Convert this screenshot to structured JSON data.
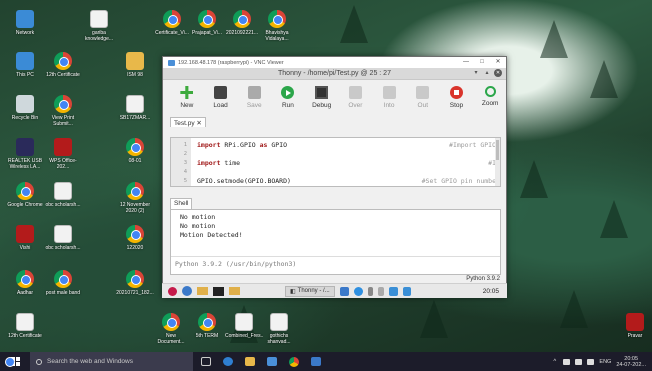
{
  "desktop": {
    "icons": [
      {
        "label": "Network",
        "icon": "network-icon"
      },
      {
        "label": "gariba knowledge...",
        "icon": "document-icon"
      },
      {
        "label": "Certificate_Vi...",
        "icon": "chrome-icon"
      },
      {
        "label": "Prajapat_Vi...",
        "icon": "chrome-icon"
      },
      {
        "label": "2021092221...",
        "icon": "chrome-icon"
      },
      {
        "label": "Bhavishya Vidalaya...",
        "icon": "chrome-icon"
      },
      {
        "label": "This PC",
        "icon": "this-pc-icon"
      },
      {
        "label": "12th Certificate",
        "icon": "chrome-icon"
      },
      {
        "label": "ISM 98",
        "icon": "folder-icon"
      },
      {
        "label": "Recycle Bin",
        "icon": "recycle-bin-icon"
      },
      {
        "label": "View Print Submit...",
        "icon": "chrome-icon"
      },
      {
        "label": "SB17ZMAR...",
        "icon": "document-icon"
      },
      {
        "label": "REALTEK USB Wireless LA...",
        "icon": "realtek-icon"
      },
      {
        "label": "WPS Office-202...",
        "icon": "wps-icon"
      },
      {
        "label": "08-01",
        "icon": "chrome-icon"
      },
      {
        "label": "Google Chrome",
        "icon": "chrome-icon"
      },
      {
        "label": "obc scholarsh...",
        "icon": "document-icon"
      },
      {
        "label": "12 November 2020 (2)",
        "icon": "chrome-icon"
      },
      {
        "label": "Vishi",
        "icon": "vishi-icon"
      },
      {
        "label": "obc scholarsh...",
        "icon": "document-icon"
      },
      {
        "label": "122020",
        "icon": "chrome-icon"
      },
      {
        "label": "Aadhar",
        "icon": "chrome-icon"
      },
      {
        "label": "post male band",
        "icon": "chrome-icon"
      },
      {
        "label": "20210721_182...",
        "icon": "chrome-icon"
      },
      {
        "label": "12th Certificate",
        "icon": "document-icon"
      },
      {
        "label": "New Document...",
        "icon": "chrome-icon"
      },
      {
        "label": "5th TERM",
        "icon": "chrome-icon"
      },
      {
        "label": "Combined_Fres...",
        "icon": "document-icon"
      },
      {
        "label": "gothichs shanvad...",
        "icon": "document-icon"
      },
      {
        "label": "Pravar",
        "icon": "pravar-icon"
      }
    ]
  },
  "vnc": {
    "title": "192.168.48.178 (raspberrypi) - VNC Viewer",
    "controls": [
      "—",
      "□",
      "✕"
    ]
  },
  "thonny": {
    "title": "Thonny  -  /home/pi/Test.py  @  25 : 27",
    "toolbar": [
      {
        "label": "New",
        "icon": "new-icon",
        "enabled": true
      },
      {
        "label": "Load",
        "icon": "load-icon",
        "enabled": true
      },
      {
        "label": "Save",
        "icon": "save-icon",
        "enabled": false
      },
      {
        "label": "Run",
        "icon": "run-icon",
        "enabled": true
      },
      {
        "label": "Debug",
        "icon": "debug-icon",
        "enabled": true
      },
      {
        "label": "Over",
        "icon": "step-over-icon",
        "enabled": false
      },
      {
        "label": "Into",
        "icon": "step-into-icon",
        "enabled": false
      },
      {
        "label": "Out",
        "icon": "step-out-icon",
        "enabled": false
      },
      {
        "label": "Stop",
        "icon": "stop-icon",
        "enabled": true
      },
      {
        "label": "Zoom",
        "icon": "zoom-icon",
        "enabled": true
      }
    ],
    "editor_tab": "Test.py ✕",
    "code_lines": [
      {
        "n": "1",
        "kw": "import",
        "rest": " RPi.GPIO ",
        "kw2": "as",
        "rest2": " GPIO",
        "comment": "#Import GPIO"
      },
      {
        "n": "2",
        "kw": "",
        "rest": "",
        "kw2": "",
        "rest2": "",
        "comment": ""
      },
      {
        "n": "3",
        "kw": "import",
        "rest": " time",
        "kw2": "",
        "rest2": "",
        "comment": "#I"
      },
      {
        "n": "4",
        "kw": "",
        "rest": "",
        "kw2": "",
        "rest2": "",
        "comment": ""
      },
      {
        "n": "5",
        "kw": "",
        "rest": "GPIO.setmode(GPIO.BOARD)",
        "kw2": "",
        "rest2": "",
        "comment": "#Set GPIO pin numbe"
      }
    ],
    "shell_tab": "Shell",
    "shell_output": [
      "No motion",
      "No motion",
      "Motion Detected!"
    ],
    "shell_prompt": "Python 3.9.2 (/usr/bin/python3)",
    "status": "Python 3.9.2"
  },
  "pi_taskbar": {
    "task_label": "Thonny - /...",
    "clock": "20:05"
  },
  "windows_taskbar": {
    "search_placeholder": "Search the web and Windows",
    "lang": "ENG",
    "time": "20:05",
    "date": "24-07-202..."
  }
}
